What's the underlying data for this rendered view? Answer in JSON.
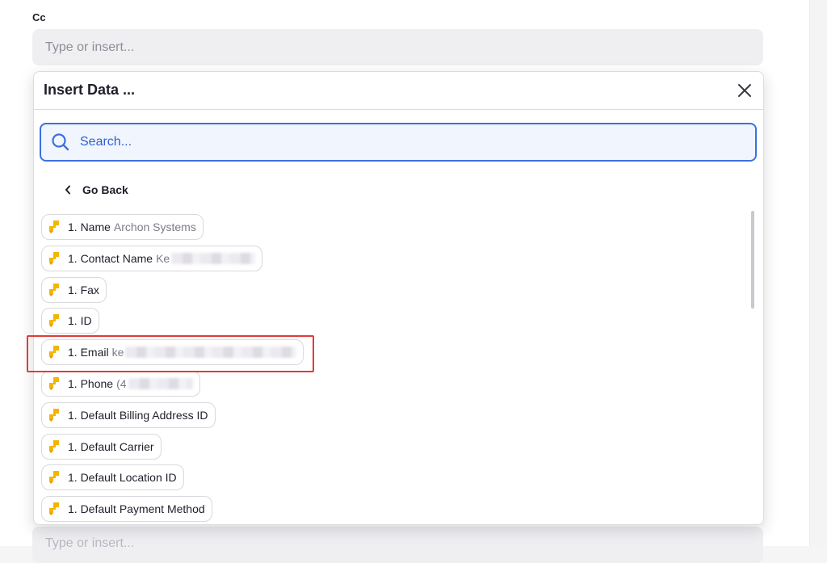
{
  "cc": {
    "label": "Cc",
    "placeholder": "Type or insert..."
  },
  "next_field": {
    "placeholder": "Type or insert..."
  },
  "modal": {
    "title": "Insert Data ...",
    "close_icon": "close-icon",
    "search_placeholder": "Search...",
    "go_back_label": "Go Back",
    "items": [
      {
        "key": "1. Name",
        "value": "Archon Systems",
        "redacted": false
      },
      {
        "key": "1. Contact Name",
        "value": "Ke",
        "redacted": true
      },
      {
        "key": "1. Fax",
        "value": "",
        "redacted": false
      },
      {
        "key": "1. ID",
        "value": "",
        "redacted": false
      },
      {
        "key": "1. Email",
        "value": "ke",
        "redacted": true
      },
      {
        "key": "1. Phone",
        "value": "(4",
        "redacted": true
      },
      {
        "key": "1. Default Billing Address ID",
        "value": "",
        "redacted": false
      },
      {
        "key": "1. Default Carrier",
        "value": "",
        "redacted": false
      },
      {
        "key": "1. Default Location ID",
        "value": "",
        "redacted": false
      },
      {
        "key": "1. Default Payment Method",
        "value": "",
        "redacted": false
      }
    ]
  },
  "colors": {
    "accent": "#3d6fe0",
    "zap_icon": "#f5b400",
    "highlight": "#e23b3b"
  }
}
